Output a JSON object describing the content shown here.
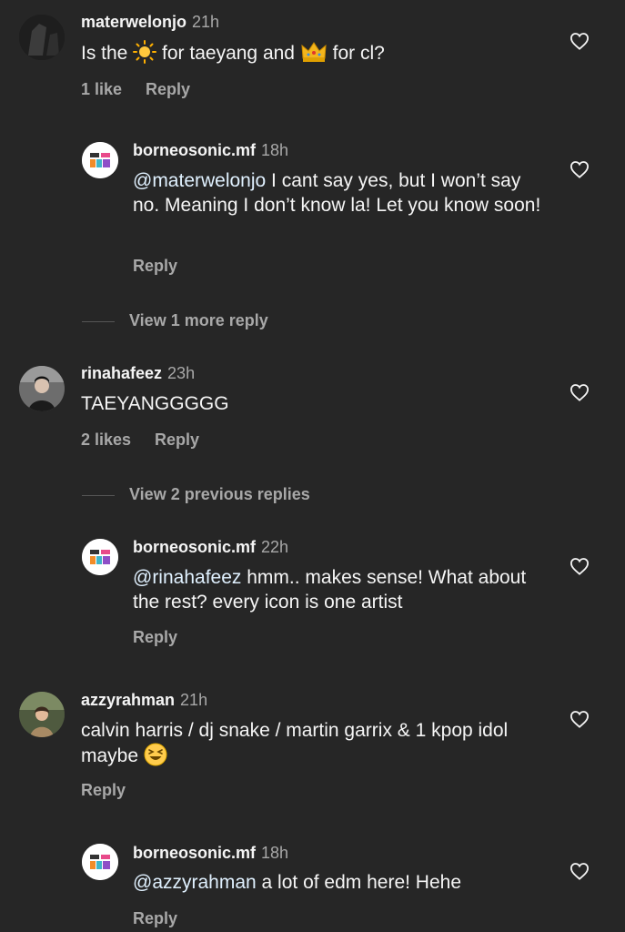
{
  "comments": [
    {
      "user": "materwelonjo",
      "time": "21h",
      "text_parts": [
        "Is the ",
        " for taeyang  and ",
        " for cl?"
      ],
      "likes": "1 like",
      "reply": "Reply"
    },
    {
      "user": "borneosonic.mf",
      "time": "18h",
      "mention": "@materwelonjo",
      "text": " I cant say yes, but I won’t say no. Meaning I don’t know la! Let you know soon!",
      "reply": "Reply"
    },
    {
      "user": "rinahafeez",
      "time": "23h",
      "text": "TAEYANGGGGG",
      "likes": "2 likes",
      "reply": "Reply"
    },
    {
      "user": "borneosonic.mf",
      "time": "22h",
      "mention": "@rinahafeez",
      "text": " hmm.. makes sense! What about the rest? every icon is one artist",
      "reply": "Reply"
    },
    {
      "user": "azzyrahman",
      "time": "21h",
      "text": "calvin harris / dj snake / martin garrix & 1 kpop idol maybe ",
      "reply": "Reply"
    },
    {
      "user": "borneosonic.mf",
      "time": "18h",
      "mention": "@azzyrahman",
      "text": " a lot of edm here! Hehe",
      "reply": "Reply"
    }
  ],
  "view_more_1": "View 1 more reply",
  "view_previous_2": "View 2 previous replies",
  "colors": {
    "background": "#262626",
    "text": "#f5f5f5",
    "muted": "#a8a8a8",
    "mention": "#e0f1ff"
  },
  "icons": [
    "heart-outline-icon",
    "sun-emoji",
    "crown-emoji",
    "laughing-emoji"
  ]
}
